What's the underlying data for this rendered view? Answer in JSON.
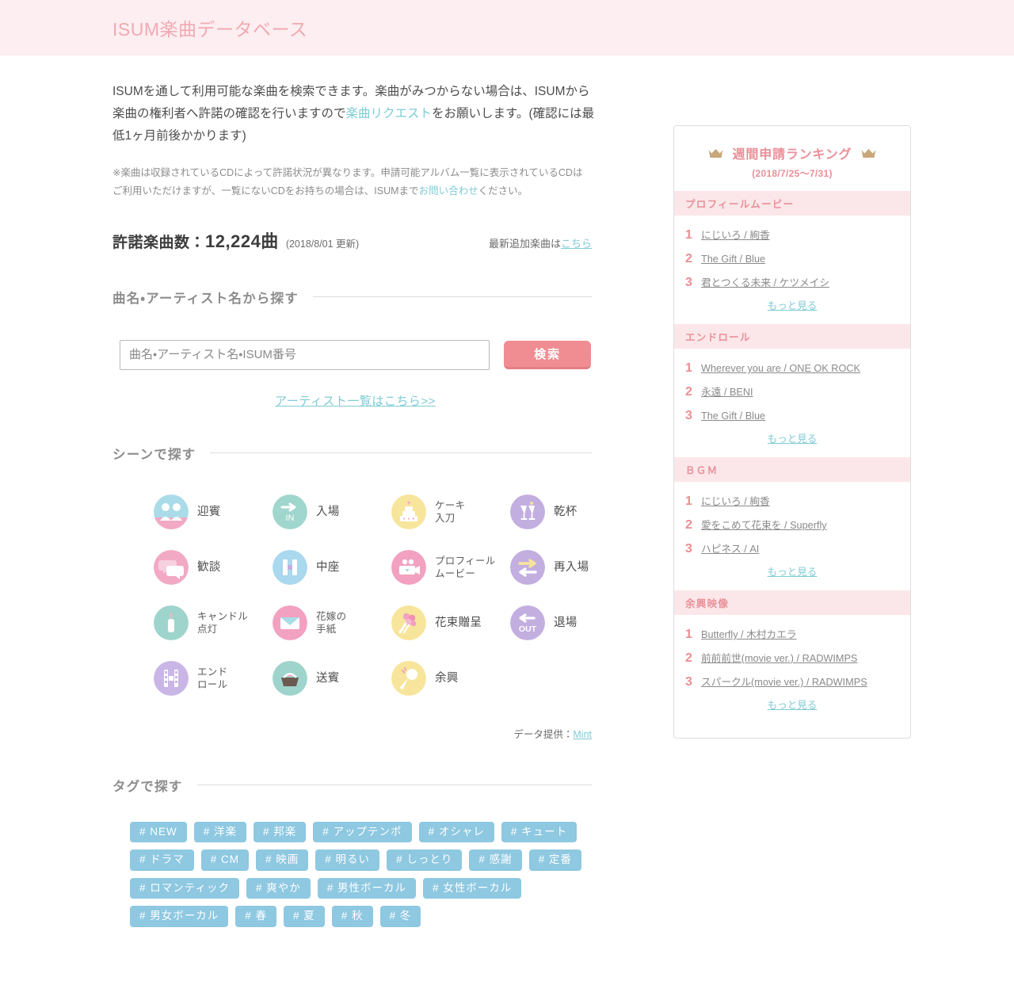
{
  "header": {
    "title": "ISUM楽曲データベース"
  },
  "intro": {
    "part1": "ISUMを通して利用可能な楽曲を検索できます。楽曲がみつからない場合は、ISUMから楽曲の権利者へ許諾の確認を行いますので",
    "link": "楽曲リクエスト",
    "part2": "をお願いします。(確認には最低1ヶ月前後かかります)",
    "note1": "※楽曲は収録されているCDによって許諾状況が異なります。申請可能アルバム一覧に表示されているCDはご利用いただけますが、一覧にないCDをお持ちの場合は、ISUMまで",
    "note_link": "お問い合わせ",
    "note2": "ください。"
  },
  "stats": {
    "label": "許諾楽曲数：",
    "count": "12,224曲",
    "updated": "(2018/8/01 更新)",
    "latest_prefix": "最新追加楽曲は",
    "latest_link": "こちら"
  },
  "search": {
    "section_title": "曲名・アーティスト名から探す",
    "placeholder": "曲名・アーティスト名・ISUM番号",
    "value": "",
    "button": "検索",
    "artist_list_link": "アーティスト一覧はこちら>>"
  },
  "scene": {
    "section_title": "シーンで探す",
    "items": [
      {
        "label": "迎賓",
        "icon": "greeting-icon",
        "color": "#a9dce8"
      },
      {
        "label": "入場",
        "icon": "entrance-in-icon",
        "color": "#9fd6cd"
      },
      {
        "label": "ケーキ\n入刀",
        "icon": "cake-cut-icon",
        "color": "#f7e59b",
        "small": true
      },
      {
        "label": "乾杯",
        "icon": "toast-glasses-icon",
        "color": "#c3aee0"
      },
      {
        "label": "歓談",
        "icon": "chat-bubbles-icon",
        "color": "#f2a9c4"
      },
      {
        "label": "中座",
        "icon": "exit-pillars-icon",
        "color": "#a9d8ef"
      },
      {
        "label": "プロフィール\nムービー",
        "icon": "profile-movie-icon",
        "color": "#f2a1c0",
        "small": true
      },
      {
        "label": "再入場",
        "icon": "re-entrance-icon",
        "color": "#c3aee0"
      },
      {
        "label": "キャンドル\n点灯",
        "icon": "candle-icon",
        "color": "#9ed4cc",
        "small": true
      },
      {
        "label": "花嫁の\n手紙",
        "icon": "bride-letter-icon",
        "color": "#f2a1c0",
        "small": true
      },
      {
        "label": "花束贈呈",
        "icon": "bouquet-icon",
        "color": "#f7e59b"
      },
      {
        "label": "退場",
        "icon": "exit-out-icon",
        "color": "#c3aee0"
      },
      {
        "label": "エンド\nロール",
        "icon": "film-roll-icon",
        "color": "#c9b6e6",
        "small": true
      },
      {
        "label": "送賓",
        "icon": "basket-icon",
        "color": "#9ed4cc"
      },
      {
        "label": "余興",
        "icon": "microphone-icon",
        "color": "#f7e59b"
      }
    ],
    "credit_prefix": "データ提供：",
    "credit_link": "Mint"
  },
  "tags": {
    "section_title": "タグで探す",
    "rows": [
      [
        "# NEW",
        "# 洋楽",
        "# 邦楽",
        "# アップテンポ",
        "# オシャレ",
        "# キュート"
      ],
      [
        "# ドラマ",
        "# CM",
        "# 映画",
        "# 明るい",
        "# しっとり",
        "# 感謝",
        "# 定番"
      ],
      [
        "# ロマンティック",
        "# 爽やか",
        "# 男性ボーカル",
        "# 女性ボーカル"
      ],
      [
        "# 男女ボーカル",
        "# 春",
        "# 夏",
        "# 秋",
        "# 冬"
      ]
    ]
  },
  "ranking": {
    "title": "週間申請ランキング",
    "period": "(2018/7/25〜7/31)",
    "more_label": "もっと見る",
    "sections": [
      {
        "name": "プロフィールムービー",
        "entries": [
          {
            "rank": "1",
            "text": "にじいろ / 絢香"
          },
          {
            "rank": "2",
            "text": "The Gift / Blue"
          },
          {
            "rank": "3",
            "text": "君とつくる未来 / ケツメイシ"
          }
        ]
      },
      {
        "name": "エンドロール",
        "entries": [
          {
            "rank": "1",
            "text": "Wherever you are / ONE OK ROCK"
          },
          {
            "rank": "2",
            "text": "永遠 / BENI"
          },
          {
            "rank": "3",
            "text": "The Gift / Blue"
          }
        ]
      },
      {
        "name": "ＢＧＭ",
        "entries": [
          {
            "rank": "1",
            "text": "にじいろ / 絢香"
          },
          {
            "rank": "2",
            "text": "愛をこめて花束を / Superfly"
          },
          {
            "rank": "3",
            "text": "ハピネス / AI"
          }
        ]
      },
      {
        "name": "余興映像",
        "entries": [
          {
            "rank": "1",
            "text": "Butterfly / 木村カエラ"
          },
          {
            "rank": "2",
            "text": "前前前世(movie ver.) / RADWIMPS"
          },
          {
            "rank": "3",
            "text": "スパークル(movie ver.) / RADWIMPS"
          }
        ]
      }
    ]
  },
  "colors": {
    "header_band": "#fdeef1",
    "title_pink": "#f0aab2",
    "accent_pink": "#ee8d93",
    "link_teal": "#7ecbd5",
    "tag_blue": "#8ec8e1",
    "crown_gold": "#c8a87a"
  }
}
